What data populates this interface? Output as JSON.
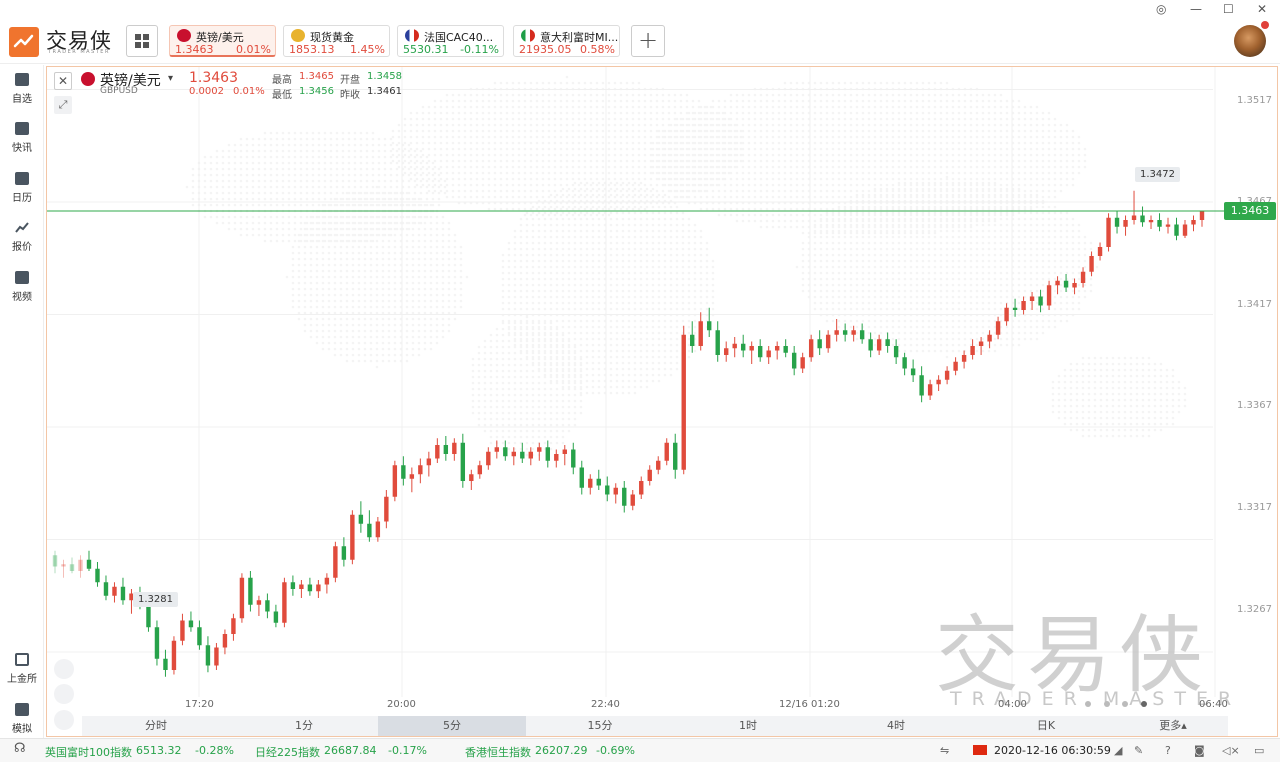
{
  "app": {
    "logo_text": "交易侠",
    "logo_sub": "TRADER MASTER"
  },
  "tickers": [
    {
      "name": "英镑/美元",
      "price": "1.3463",
      "change": "0.01%",
      "dir": "up",
      "active": true,
      "flag_color": "#c8102e"
    },
    {
      "name": "现货黄金",
      "price": "1853.13",
      "change": "1.45%",
      "dir": "up",
      "active": false,
      "flag_color": "#e8b32e"
    },
    {
      "name": "法国CAC40...",
      "price": "5530.31",
      "change": "-0.11%",
      "dir": "down",
      "active": false,
      "flag_color": "#2a3f9c"
    },
    {
      "name": "意大利富时MI...",
      "price": "21935.05",
      "change": "0.58%",
      "dir": "up",
      "active": false,
      "flag_color": "#1f9e47"
    }
  ],
  "window_controls": {
    "minimize": "—",
    "maximize": "☐",
    "close": "✕",
    "settings": "◎"
  },
  "sidebar": {
    "items": [
      {
        "label": "自选",
        "icon": "watchlist-icon"
      },
      {
        "label": "快讯",
        "icon": "news-icon"
      },
      {
        "label": "日历",
        "icon": "calendar-icon"
      },
      {
        "label": "报价",
        "icon": "quote-icon"
      },
      {
        "label": "视频",
        "icon": "video-icon"
      }
    ],
    "bottom_items": [
      {
        "label": "上金所",
        "icon": "exchange-icon"
      },
      {
        "label": "模拟",
        "icon": "simulate-icon"
      }
    ]
  },
  "chart_header": {
    "name": "英镑/美元",
    "code": "GBPUSD",
    "price": "1.3463",
    "change": "0.0002",
    "change_pct": "0.01%",
    "high_label": "最高",
    "high": "1.3465",
    "open_label": "开盘",
    "open": "1.3458",
    "low_label": "最低",
    "low": "1.3456",
    "prev_close_label": "昨收",
    "prev_close": "1.3461"
  },
  "chart_data": {
    "type": "candlestick",
    "ylim": [
      1.3247,
      1.3527
    ],
    "y_ticks": [
      "1.3517",
      "1.3467",
      "1.3417",
      "1.3367",
      "1.3317",
      "1.3267"
    ],
    "x_ticks": [
      "17:20",
      "20:00",
      "22:40",
      "12/16 01:20",
      "04:00",
      "06:40"
    ],
    "current_price": "1.3463",
    "high_marker": "1.3472",
    "low_marker": "1.3281",
    "grid": true,
    "candles": [
      [
        1.331,
        1.3312,
        1.3302,
        1.3305
      ],
      [
        1.3305,
        1.3308,
        1.33,
        1.3306
      ],
      [
        1.3306,
        1.3309,
        1.3302,
        1.3303
      ],
      [
        1.3303,
        1.331,
        1.33,
        1.3308
      ],
      [
        1.3308,
        1.3312,
        1.3303,
        1.3304
      ],
      [
        1.3304,
        1.3307,
        1.3296,
        1.3298
      ],
      [
        1.3298,
        1.3301,
        1.329,
        1.3292
      ],
      [
        1.3292,
        1.3298,
        1.3289,
        1.3296
      ],
      [
        1.3296,
        1.33,
        1.3288,
        1.329
      ],
      [
        1.329,
        1.3295,
        1.3284,
        1.3293
      ],
      [
        1.3293,
        1.3296,
        1.3286,
        1.3288
      ],
      [
        1.3288,
        1.3292,
        1.3276,
        1.3278
      ],
      [
        1.3278,
        1.3281,
        1.3261,
        1.3264
      ],
      [
        1.3264,
        1.3268,
        1.3256,
        1.3259
      ],
      [
        1.3259,
        1.3274,
        1.3257,
        1.3272
      ],
      [
        1.3272,
        1.3284,
        1.327,
        1.3281
      ],
      [
        1.3281,
        1.3285,
        1.3276,
        1.3278
      ],
      [
        1.3278,
        1.3281,
        1.3268,
        1.327
      ],
      [
        1.327,
        1.3274,
        1.3258,
        1.3261
      ],
      [
        1.3261,
        1.3271,
        1.3259,
        1.3269
      ],
      [
        1.3269,
        1.3277,
        1.3266,
        1.3275
      ],
      [
        1.3275,
        1.3284,
        1.3272,
        1.3282
      ],
      [
        1.3282,
        1.3302,
        1.328,
        1.33
      ],
      [
        1.33,
        1.3303,
        1.3285,
        1.3288
      ],
      [
        1.3288,
        1.3292,
        1.3283,
        1.329
      ],
      [
        1.329,
        1.3293,
        1.3282,
        1.3285
      ],
      [
        1.3285,
        1.3288,
        1.3278,
        1.328
      ],
      [
        1.328,
        1.33,
        1.3278,
        1.3298
      ],
      [
        1.3298,
        1.3301,
        1.3292,
        1.3295
      ],
      [
        1.3295,
        1.3299,
        1.3291,
        1.3297
      ],
      [
        1.3297,
        1.33,
        1.3292,
        1.3294
      ],
      [
        1.3294,
        1.3299,
        1.3291,
        1.3297
      ],
      [
        1.3297,
        1.3302,
        1.3293,
        1.33
      ],
      [
        1.33,
        1.3316,
        1.3298,
        1.3314
      ],
      [
        1.3314,
        1.3318,
        1.3305,
        1.3308
      ],
      [
        1.3308,
        1.333,
        1.3306,
        1.3328
      ],
      [
        1.3328,
        1.3334,
        1.332,
        1.3324
      ],
      [
        1.3324,
        1.333,
        1.3316,
        1.3318
      ],
      [
        1.3318,
        1.3327,
        1.3316,
        1.3325
      ],
      [
        1.3325,
        1.3339,
        1.3322,
        1.3336
      ],
      [
        1.3336,
        1.3352,
        1.3334,
        1.335
      ],
      [
        1.335,
        1.3354,
        1.3341,
        1.3344
      ],
      [
        1.3344,
        1.3349,
        1.3338,
        1.3346
      ],
      [
        1.3346,
        1.3353,
        1.3342,
        1.335
      ],
      [
        1.335,
        1.3356,
        1.3345,
        1.3353
      ],
      [
        1.3353,
        1.3362,
        1.3351,
        1.3359
      ],
      [
        1.3359,
        1.3363,
        1.3352,
        1.3355
      ],
      [
        1.3355,
        1.3362,
        1.3352,
        1.336
      ],
      [
        1.336,
        1.3364,
        1.334,
        1.3343
      ],
      [
        1.3343,
        1.3348,
        1.3339,
        1.3346
      ],
      [
        1.3346,
        1.3352,
        1.3344,
        1.335
      ],
      [
        1.335,
        1.3358,
        1.3348,
        1.3356
      ],
      [
        1.3356,
        1.3361,
        1.3353,
        1.3358
      ],
      [
        1.3358,
        1.3361,
        1.3352,
        1.3354
      ],
      [
        1.3354,
        1.3358,
        1.335,
        1.3356
      ],
      [
        1.3356,
        1.336,
        1.3351,
        1.3353
      ],
      [
        1.3353,
        1.3358,
        1.335,
        1.3356
      ],
      [
        1.3356,
        1.336,
        1.3352,
        1.3358
      ],
      [
        1.3358,
        1.3361,
        1.3349,
        1.3352
      ],
      [
        1.3352,
        1.3357,
        1.3349,
        1.3355
      ],
      [
        1.3355,
        1.3359,
        1.335,
        1.3357
      ],
      [
        1.3357,
        1.336,
        1.3346,
        1.3349
      ],
      [
        1.3349,
        1.3352,
        1.3337,
        1.334
      ],
      [
        1.334,
        1.3346,
        1.3337,
        1.3344
      ],
      [
        1.3344,
        1.3348,
        1.3339,
        1.3341
      ],
      [
        1.3341,
        1.3345,
        1.3334,
        1.3337
      ],
      [
        1.3337,
        1.3342,
        1.3333,
        1.334
      ],
      [
        1.334,
        1.3343,
        1.3329,
        1.3332
      ],
      [
        1.3332,
        1.3339,
        1.333,
        1.3337
      ],
      [
        1.3337,
        1.3345,
        1.3335,
        1.3343
      ],
      [
        1.3343,
        1.335,
        1.3341,
        1.3348
      ],
      [
        1.3348,
        1.3354,
        1.3346,
        1.3352
      ],
      [
        1.3352,
        1.3362,
        1.335,
        1.336
      ],
      [
        1.336,
        1.3364,
        1.3344,
        1.3348
      ],
      [
        1.3348,
        1.3412,
        1.3346,
        1.3408
      ],
      [
        1.3408,
        1.3414,
        1.34,
        1.3403
      ],
      [
        1.3403,
        1.3418,
        1.3401,
        1.3414
      ],
      [
        1.3414,
        1.342,
        1.3407,
        1.341
      ],
      [
        1.341,
        1.3414,
        1.3396,
        1.3399
      ],
      [
        1.3399,
        1.3405,
        1.3396,
        1.3402
      ],
      [
        1.3402,
        1.3407,
        1.3398,
        1.3404
      ],
      [
        1.3404,
        1.3408,
        1.3398,
        1.3401
      ],
      [
        1.3401,
        1.3405,
        1.3395,
        1.3403
      ],
      [
        1.3403,
        1.3406,
        1.3396,
        1.3398
      ],
      [
        1.3398,
        1.3403,
        1.3395,
        1.3401
      ],
      [
        1.3401,
        1.3405,
        1.3397,
        1.3403
      ],
      [
        1.3403,
        1.3406,
        1.3398,
        1.34
      ],
      [
        1.34,
        1.3403,
        1.339,
        1.3393
      ],
      [
        1.3393,
        1.34,
        1.3391,
        1.3398
      ],
      [
        1.3398,
        1.3408,
        1.3396,
        1.3406
      ],
      [
        1.3406,
        1.341,
        1.3399,
        1.3402
      ],
      [
        1.3402,
        1.341,
        1.34,
        1.3408
      ],
      [
        1.3408,
        1.3415,
        1.3405,
        1.341
      ],
      [
        1.341,
        1.3413,
        1.3405,
        1.3408
      ],
      [
        1.3408,
        1.3412,
        1.3405,
        1.341
      ],
      [
        1.341,
        1.3413,
        1.3404,
        1.3406
      ],
      [
        1.3406,
        1.3409,
        1.3398,
        1.3401
      ],
      [
        1.3401,
        1.3408,
        1.3399,
        1.3406
      ],
      [
        1.3406,
        1.3409,
        1.34,
        1.3403
      ],
      [
        1.3403,
        1.3406,
        1.3395,
        1.3398
      ],
      [
        1.3398,
        1.34,
        1.339,
        1.3393
      ],
      [
        1.3393,
        1.3397,
        1.3387,
        1.339
      ],
      [
        1.339,
        1.3394,
        1.3378,
        1.3381
      ],
      [
        1.3381,
        1.3388,
        1.3379,
        1.3386
      ],
      [
        1.3386,
        1.339,
        1.3383,
        1.3388
      ],
      [
        1.3388,
        1.3394,
        1.3386,
        1.3392
      ],
      [
        1.3392,
        1.3398,
        1.339,
        1.3396
      ],
      [
        1.3396,
        1.3401,
        1.3393,
        1.3399
      ],
      [
        1.3399,
        1.3406,
        1.3397,
        1.3403
      ],
      [
        1.3403,
        1.3407,
        1.3399,
        1.3405
      ],
      [
        1.3405,
        1.341,
        1.3402,
        1.3408
      ],
      [
        1.3408,
        1.3416,
        1.3406,
        1.3414
      ],
      [
        1.3414,
        1.3422,
        1.3412,
        1.342
      ],
      [
        1.342,
        1.3424,
        1.3416,
        1.3419
      ],
      [
        1.3419,
        1.3425,
        1.3417,
        1.3423
      ],
      [
        1.3423,
        1.3427,
        1.3419,
        1.3425
      ],
      [
        1.3425,
        1.3428,
        1.3418,
        1.3421
      ],
      [
        1.3421,
        1.3432,
        1.3419,
        1.343
      ],
      [
        1.343,
        1.3434,
        1.3426,
        1.3432
      ],
      [
        1.3432,
        1.3435,
        1.3427,
        1.3429
      ],
      [
        1.3429,
        1.3433,
        1.3426,
        1.3431
      ],
      [
        1.3431,
        1.3438,
        1.3429,
        1.3436
      ],
      [
        1.3436,
        1.3445,
        1.3434,
        1.3443
      ],
      [
        1.3443,
        1.3449,
        1.3441,
        1.3447
      ],
      [
        1.3447,
        1.3462,
        1.3445,
        1.346
      ],
      [
        1.346,
        1.3463,
        1.3453,
        1.3456
      ],
      [
        1.3456,
        1.3461,
        1.3452,
        1.3459
      ],
      [
        1.3459,
        1.3472,
        1.3457,
        1.3461
      ],
      [
        1.3461,
        1.3465,
        1.3456,
        1.3458
      ],
      [
        1.3458,
        1.3461,
        1.3455,
        1.3459
      ],
      [
        1.3459,
        1.3462,
        1.3454,
        1.3456
      ],
      [
        1.3456,
        1.346,
        1.3453,
        1.3457
      ],
      [
        1.3457,
        1.346,
        1.345,
        1.3452
      ],
      [
        1.3452,
        1.3459,
        1.3451,
        1.3457
      ],
      [
        1.3457,
        1.3461,
        1.3454,
        1.3459
      ],
      [
        1.3459,
        1.3463,
        1.3456,
        1.3463
      ]
    ]
  },
  "timeframes": [
    "分时",
    "1分",
    "5分",
    "15分",
    "1时",
    "4时",
    "日K",
    "更多▴"
  ],
  "active_timeframe": "5分",
  "statusbar": {
    "items": [
      {
        "name": "英国富时100指数",
        "value": "6513.32",
        "change": "-0.28%"
      },
      {
        "name": "日经225指数",
        "value": "26687.84",
        "change": "-0.17%"
      },
      {
        "name": "香港恒生指数",
        "value": "26207.29",
        "change": "-0.69%"
      }
    ],
    "datetime": "2020-12-16 06:30:59"
  },
  "watermark": {
    "text": "交易侠",
    "sub": "TRADER MASTER"
  },
  "colors": {
    "up": "#e04b3c",
    "down": "#27a24a",
    "accent": "#f0742e"
  }
}
